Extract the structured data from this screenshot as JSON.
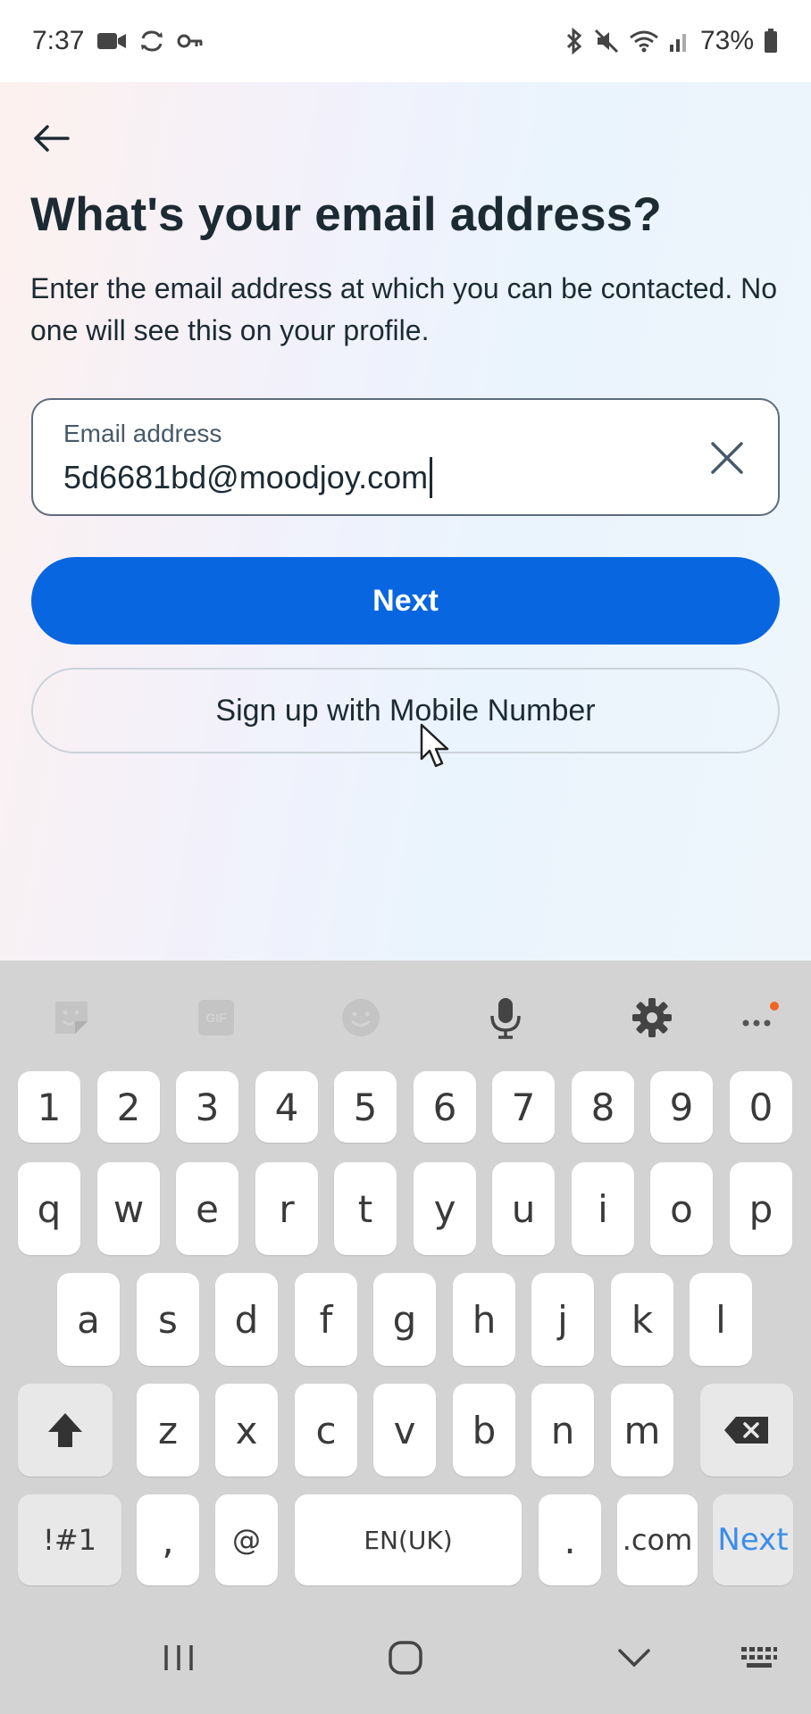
{
  "status_bar": {
    "time": "7:37",
    "battery": "73%"
  },
  "signup": {
    "title": "What's your email address?",
    "description": "Enter the email address at which you can be contacted. No one will see this on your profile.",
    "email_label": "Email address",
    "email_value": "5d6681bd@moodjoy.com",
    "next_label": "Next",
    "mobile_label": "Sign up with Mobile Number"
  },
  "keyboard": {
    "numbers": [
      "1",
      "2",
      "3",
      "4",
      "5",
      "6",
      "7",
      "8",
      "9",
      "0"
    ],
    "row1": [
      "q",
      "w",
      "e",
      "r",
      "t",
      "y",
      "u",
      "i",
      "o",
      "p"
    ],
    "row2": [
      "a",
      "s",
      "d",
      "f",
      "g",
      "h",
      "j",
      "k",
      "l"
    ],
    "row3": [
      "z",
      "x",
      "c",
      "v",
      "b",
      "n",
      "m"
    ],
    "symbols_label": "!#1",
    "comma_label": ",",
    "at_label": "@",
    "space_label": "EN(UK)",
    "period_label": ".",
    "dotcom_label": ".com",
    "next_label": "Next",
    "gif_label": "GIF"
  },
  "colors": {
    "primary": "#0866e0",
    "keyboard_bg": "#d3d3d3",
    "notification_dot": "#f26522"
  }
}
